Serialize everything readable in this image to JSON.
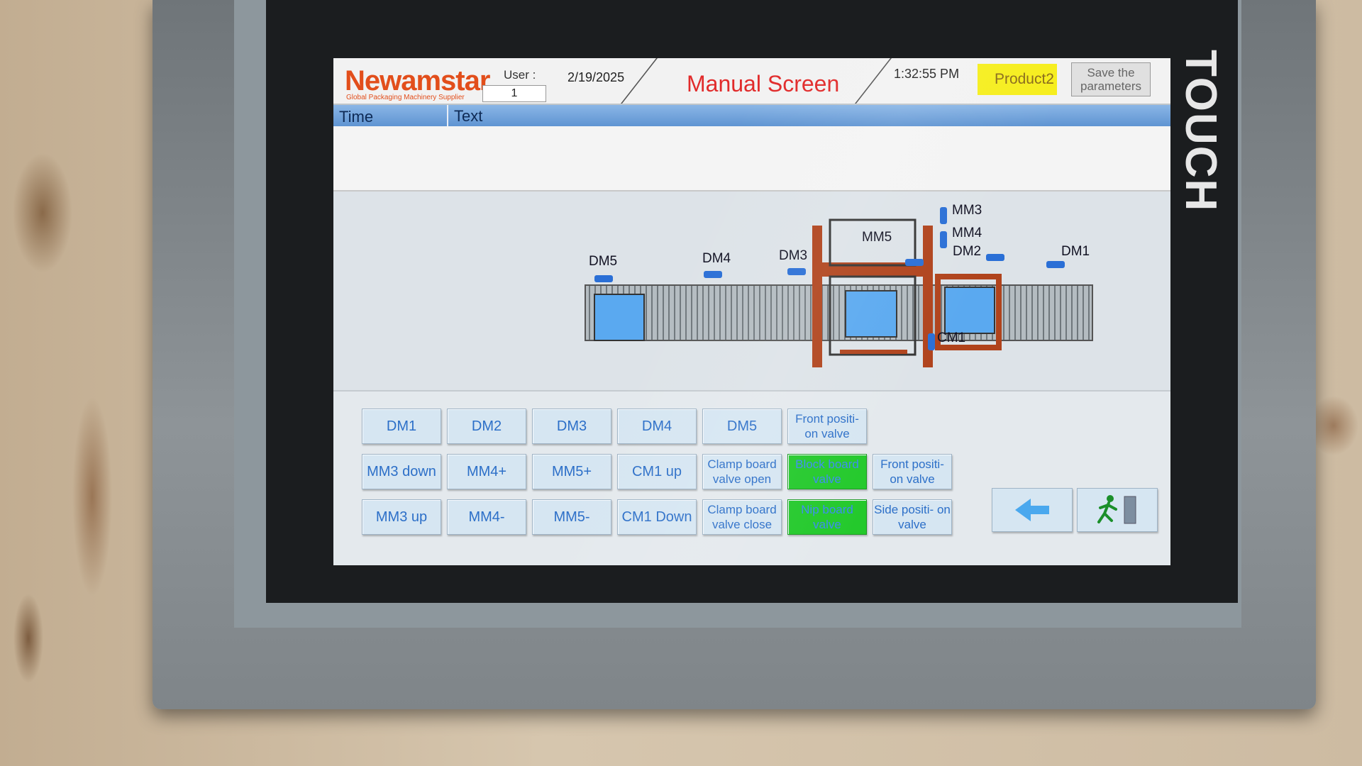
{
  "device": {
    "brand_label": "TOUCH"
  },
  "header": {
    "logo": "Newamstar",
    "tagline": "Global Packaging Machinery Supplier",
    "user_label": "User :",
    "user_value": "1",
    "date": "2/19/2025",
    "title": "Manual Screen",
    "time": "1:32:55 PM",
    "product": "Product2",
    "save_label": "Save the parameters"
  },
  "alarm_table": {
    "columns": [
      "Time",
      "Text"
    ]
  },
  "diagram": {
    "labels": {
      "dm5": "DM5",
      "dm4": "DM4",
      "dm3": "DM3",
      "dm2": "DM2",
      "dm1": "DM1",
      "mm3": "MM3",
      "mm4": "MM4",
      "mm5": "MM5",
      "cm1": "CM1"
    },
    "colors": {
      "conveyor": "#9aa3a8",
      "frame": "#b0431c",
      "box": "#5aa9f0",
      "motor": "#2a6fd6"
    }
  },
  "buttons": {
    "dm1": "DM1",
    "dm2": "DM2",
    "dm3": "DM3",
    "dm4": "DM4",
    "dm5": "DM5",
    "front_position_valve_1": "Front positi- on valve",
    "mm3_down": "MM3 down",
    "mm4_plus": "MM4+",
    "mm5_plus": "MM5+",
    "cm1_up": "CM1 up",
    "clamp_open": "Clamp board valve open",
    "block_board": "Block board valve",
    "front_position_valve_2": "Front positi- on valve",
    "mm3_up": "MM3 up",
    "mm4_minus": "MM4-",
    "mm5_minus": "MM5-",
    "cm1_down": "CM1 Down",
    "clamp_close": "Clamp board valve close",
    "nip_board": "Nip board valve",
    "side_position_valve": "Side positi- on valve"
  },
  "status_colors": {
    "active_green": "#23c92b",
    "product_yellow": "#f6ee1d",
    "title_red": "#e12b2b"
  },
  "nav": {
    "back_icon": "arrow-left-icon",
    "exit_icon": "exit-person-icon"
  }
}
